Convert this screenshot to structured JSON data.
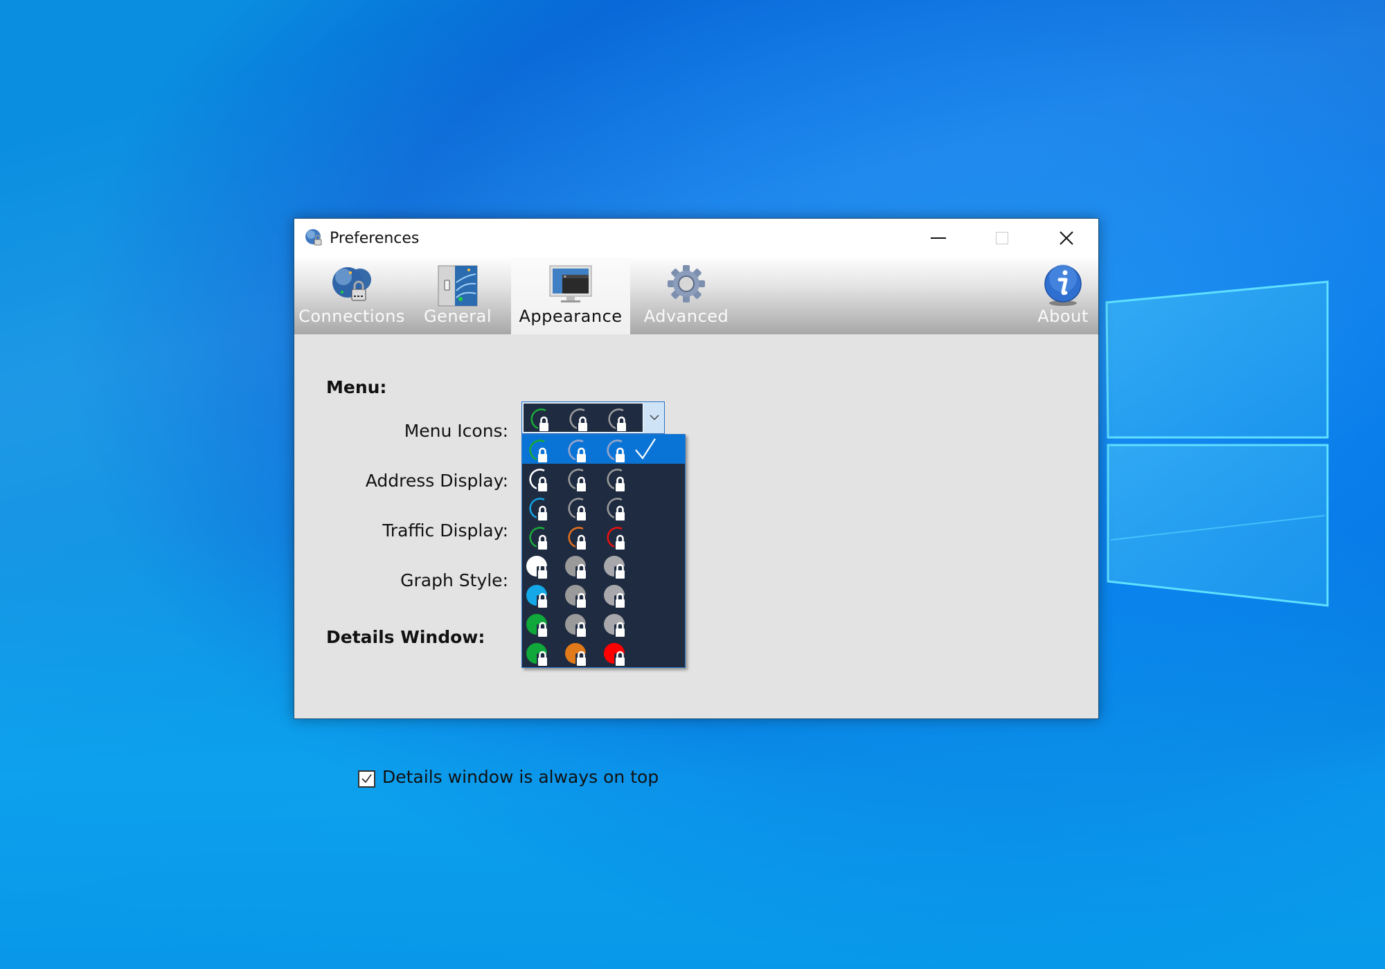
{
  "window": {
    "title": "Preferences",
    "controls": {
      "minimize": "minimize-icon",
      "maximize": "maximize-icon",
      "close": "close-icon"
    }
  },
  "toolbar": {
    "tabs": [
      {
        "label": "Connections",
        "icon": "globe-lock-icon",
        "selected": false
      },
      {
        "label": "General",
        "icon": "switch-panel-icon",
        "selected": false
      },
      {
        "label": "Appearance",
        "icon": "monitor-icon",
        "selected": true
      },
      {
        "label": "Advanced",
        "icon": "gear-icon",
        "selected": false
      },
      {
        "label": "About",
        "icon": "info-icon",
        "selected": false
      }
    ]
  },
  "content": {
    "menu_section": "Menu:",
    "menu_icons_label": "Menu Icons:",
    "address_display_label": "Address Display:",
    "traffic_display_label": "Traffic Display:",
    "graph_style_label": "Graph Style:",
    "details_section": "Details Window:",
    "details_checkbox": {
      "label": "Details window is always on top",
      "checked": true
    }
  },
  "menu_icons_dropdown": {
    "selected_index": 0,
    "current_value": {
      "style": "ring",
      "colors": [
        "#1aa83a",
        "#9a9a9a",
        "#9a9a9a"
      ]
    },
    "options": [
      {
        "style": "ring",
        "colors": [
          "#1aa83a",
          "#9aa6c8",
          "#9aa6c8"
        ]
      },
      {
        "style": "ring",
        "colors": [
          "#ffffff",
          "#9a9a9a",
          "#9a9a9a"
        ]
      },
      {
        "style": "ring",
        "colors": [
          "#14a0e0",
          "#9a9a9a",
          "#9a9a9a"
        ]
      },
      {
        "style": "ring",
        "colors": [
          "#1aa83a",
          "#e07020",
          "#e81010"
        ]
      },
      {
        "style": "disc",
        "colors": [
          "#ffffff",
          "#9a9a9a",
          "#a8a8ac"
        ]
      },
      {
        "style": "disc",
        "colors": [
          "#14a8e8",
          "#9a9a9a",
          "#a8a8ac"
        ]
      },
      {
        "style": "disc",
        "colors": [
          "#10a83a",
          "#9a9a9a",
          "#a8a8ac"
        ]
      },
      {
        "style": "disc",
        "colors": [
          "#10a83a",
          "#e07a1a",
          "#ff0000"
        ]
      }
    ]
  },
  "colors": {
    "selection": "#0a74d6",
    "dropdown_bg": "#1f2b40",
    "panel_bg": "#e3e3e3"
  }
}
